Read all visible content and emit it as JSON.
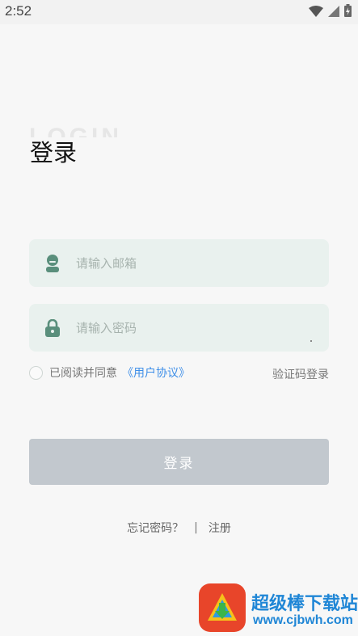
{
  "status_bar": {
    "time": "2:52",
    "icons": [
      "wifi-icon",
      "cellular-signal-icon",
      "battery-charging-icon"
    ]
  },
  "header": {
    "watermark": "LOGIN",
    "title": "登录"
  },
  "form": {
    "email": {
      "placeholder": "请输入邮箱",
      "value": "",
      "icon": "user-icon"
    },
    "password": {
      "placeholder": "请输入密码",
      "value": "",
      "icon": "lock-icon"
    },
    "agreement": {
      "checked": false,
      "text": "已阅读并同意",
      "link": "《用户协议》"
    },
    "sms_login": "验证码登录",
    "submit_label": "登录"
  },
  "footer": {
    "forgot_password": "忘记密码？",
    "separator": "|",
    "register": "注册"
  },
  "watermark_ad": {
    "title": "超级棒下载站",
    "url": "www.cjbwh.com"
  },
  "colors": {
    "field_bg": "#e9f1ee",
    "icon_green": "#5a8f7c",
    "button_disabled": "#c2c8ce",
    "link_blue": "#3f8fe8",
    "ad_blue": "#1f86d6",
    "ad_red": "#e8452a"
  }
}
